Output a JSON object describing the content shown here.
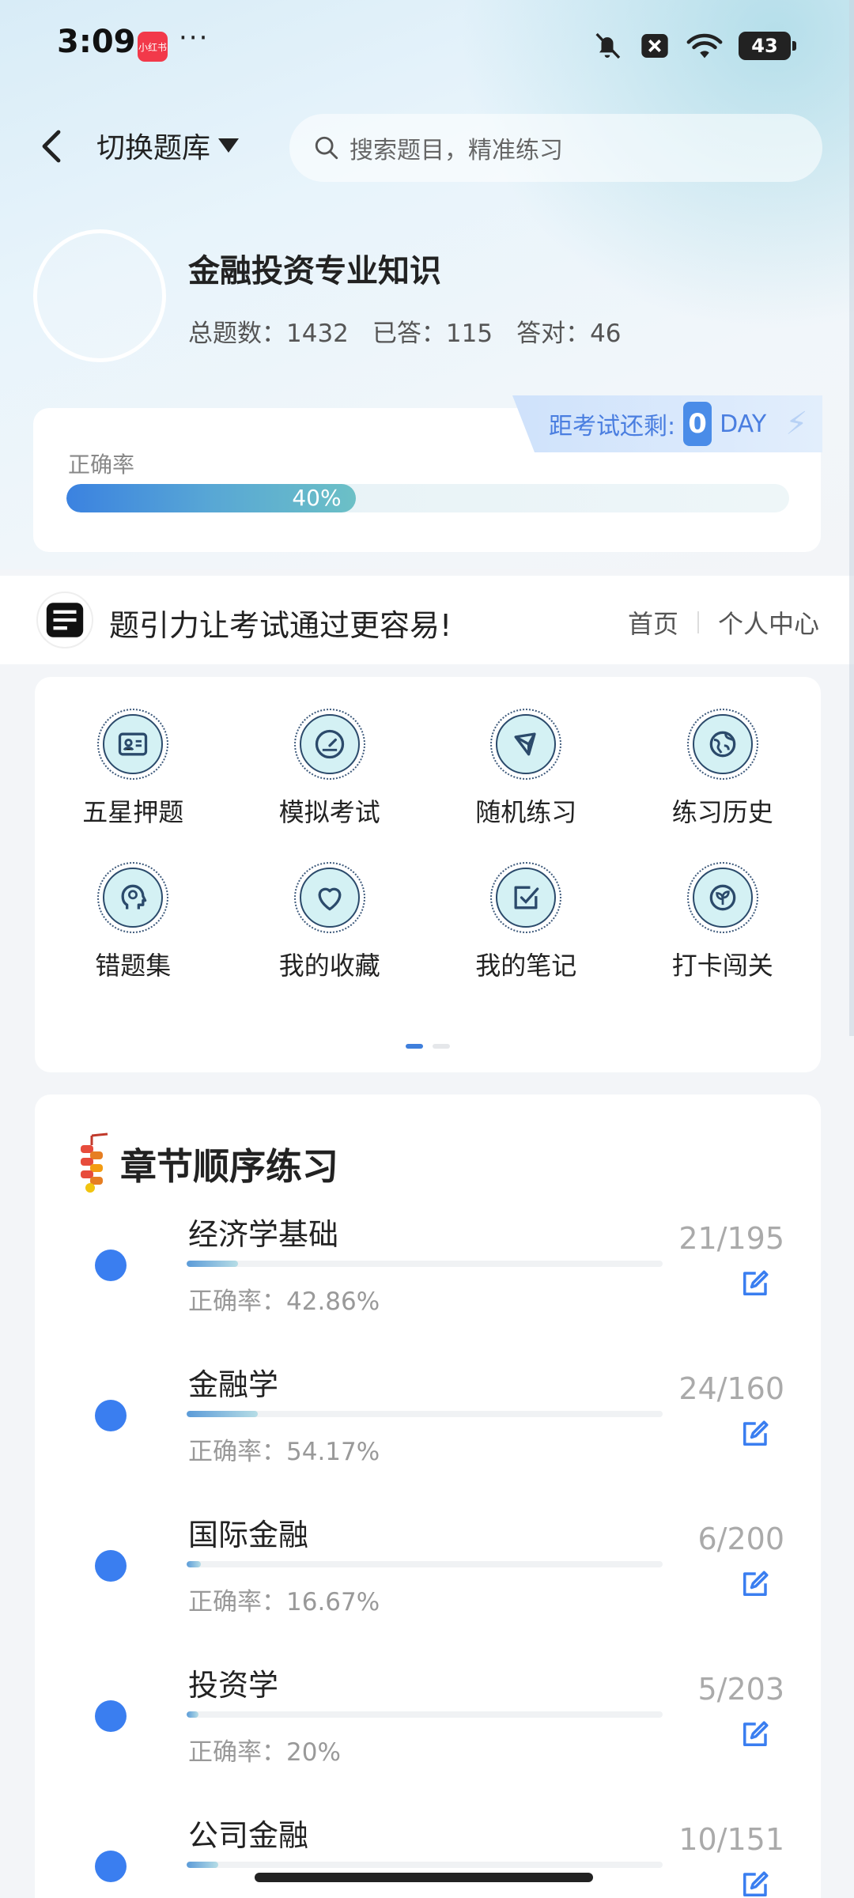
{
  "status_bar": {
    "time": "3:09",
    "app_badge": "小红书",
    "more": "···",
    "battery": "43",
    "icons": [
      "bell-off-icon",
      "close-box-icon",
      "wifi-icon",
      "battery-icon"
    ]
  },
  "header": {
    "back_icon": "chevron-left-icon",
    "switch_label": "切换题库",
    "search_placeholder": "搜索题目，精准练习"
  },
  "profile": {
    "title": "金融投资专业知识",
    "stats": [
      {
        "label": "总题数：",
        "value": "1432"
      },
      {
        "label": "已答：",
        "value": "115"
      },
      {
        "label": "答对：",
        "value": "46"
      }
    ]
  },
  "accuracy": {
    "label": "正确率",
    "value_text": "40%",
    "fraction": 0.4,
    "exam_label": "距考试还剩:",
    "exam_days": "0",
    "exam_unit": "DAY"
  },
  "slogan_bar": {
    "logo_icon": "brand-logo-icon",
    "slogan": "题引力让考试通过更容易!",
    "nav": [
      "首页",
      "个人中心"
    ]
  },
  "features": [
    {
      "label": "五星押题",
      "icon": "id-card-icon"
    },
    {
      "label": "模拟考试",
      "icon": "gauge-icon"
    },
    {
      "label": "随机练习",
      "icon": "network-icon"
    },
    {
      "label": "练习历史",
      "icon": "globe-icon"
    },
    {
      "label": "错题集",
      "icon": "head-icon"
    },
    {
      "label": "我的收藏",
      "icon": "heart-icon"
    },
    {
      "label": "我的笔记",
      "icon": "checkbox-icon"
    },
    {
      "label": "打卡闯关",
      "icon": "leaf-icon"
    }
  ],
  "chapters": {
    "title": "章节顺序练习",
    "rate_label": "正确率：",
    "items": [
      {
        "name": "经济学基础",
        "progress": "21/195",
        "rate": "42.86%",
        "done_fraction": 0.108
      },
      {
        "name": "金融学",
        "progress": "24/160",
        "rate": "54.17%",
        "done_fraction": 0.15
      },
      {
        "name": "国际金融",
        "progress": "6/200",
        "rate": "16.67%",
        "done_fraction": 0.03
      },
      {
        "name": "投资学",
        "progress": "5/203",
        "rate": "20%",
        "done_fraction": 0.025
      },
      {
        "name": "公司金融",
        "progress": "10/151",
        "rate": "",
        "done_fraction": 0.066
      }
    ]
  },
  "colors": {
    "accent": "#3a7ef0",
    "progress_start": "#3b82e0",
    "progress_end": "#6cc0c6",
    "icon_fill": "#d4f1f4",
    "icon_stroke": "#2b4a6b"
  }
}
